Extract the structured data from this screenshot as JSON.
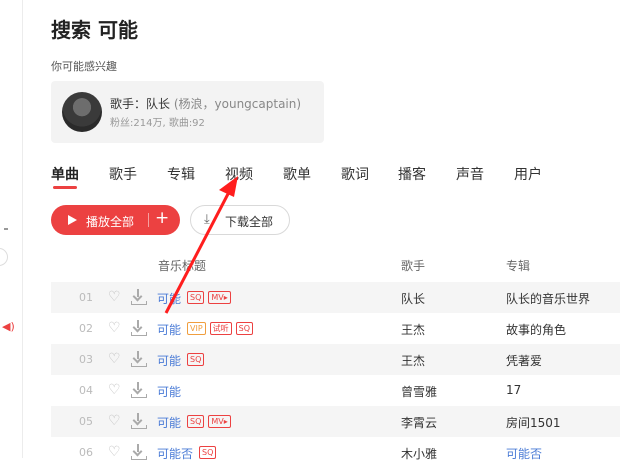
{
  "page": {
    "title": "搜索 可能",
    "interest_label": "你可能感兴趣"
  },
  "artist_card": {
    "prefix": "歌手：",
    "name": "队长",
    "alias": " (杨浪，youngcaptain)",
    "stats": "粉丝:214万, 歌曲:92"
  },
  "tabs": [
    "单曲",
    "歌手",
    "专辑",
    "视频",
    "歌单",
    "歌词",
    "播客",
    "声音",
    "用户"
  ],
  "actions": {
    "play_all": "播放全部",
    "add": "+",
    "download_all": "下载全部"
  },
  "table": {
    "headers": {
      "title": "音乐标题",
      "artist": "歌手",
      "album": "专辑"
    },
    "rows": [
      {
        "index": "01",
        "title": "可能",
        "tags": [
          "SQ",
          "MV▸"
        ],
        "artist": "队长",
        "album": "队长的音乐世界"
      },
      {
        "index": "02",
        "title": "可能",
        "tags": [
          "VIP",
          "试听",
          "SQ"
        ],
        "artist": "王杰",
        "album": "故事的角色"
      },
      {
        "index": "03",
        "title": "可能",
        "tags": [
          "SQ"
        ],
        "artist": "王杰",
        "album": "凭著爱"
      },
      {
        "index": "04",
        "title": "可能",
        "tags": [],
        "artist": "曾雪雅",
        "album": "17"
      },
      {
        "index": "05",
        "title": "可能",
        "tags": [
          "SQ",
          "MV▸"
        ],
        "artist": "李霄云",
        "album": "房间1501"
      },
      {
        "index": "06",
        "title": "可能否",
        "tags": [
          "SQ"
        ],
        "artist": "木小雅",
        "album": "可能否"
      }
    ]
  },
  "colors": {
    "accent": "#ec4141",
    "link": "#4a7bd6",
    "vip": "#f09e3e"
  },
  "annotation": {
    "type": "red-arrow",
    "points_to": "视频"
  }
}
